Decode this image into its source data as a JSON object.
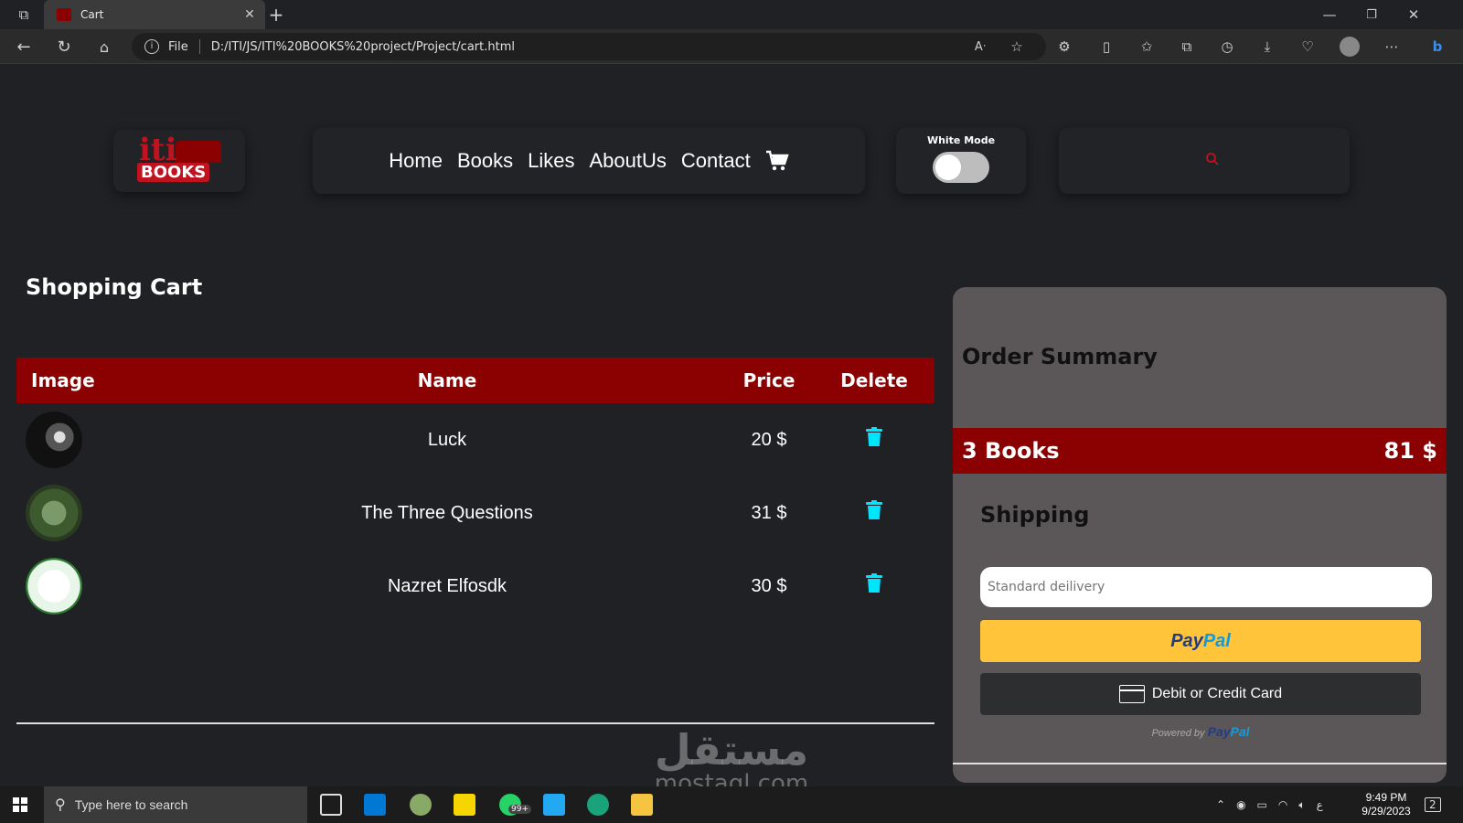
{
  "browser": {
    "tab_title": "Cart",
    "url_prefix": "File",
    "url": "D:/ITI/JS/ITI%20BOOKS%20project/Project/cart.html"
  },
  "header": {
    "logo_top": "iti",
    "logo_bottom": "BOOKS",
    "nav": [
      "Home",
      "Books",
      "Likes",
      "AboutUs",
      "Contact"
    ],
    "mode_label": "White Mode"
  },
  "cart": {
    "title": "Shopping Cart",
    "columns": [
      "Image",
      "Name",
      "Price",
      "Delete"
    ],
    "rows": [
      {
        "name": "Luck",
        "price": "20 $"
      },
      {
        "name": "The Three Questions",
        "price": "31 $"
      },
      {
        "name": "Nazret Elfosdk",
        "price": "30 $"
      }
    ]
  },
  "summary": {
    "title": "Order Summary",
    "count": "3 Books",
    "total": "81 $",
    "shipping_title": "Shipping",
    "shipping_placeholder": "Standard deilivery",
    "paypal_a": "Pay",
    "paypal_b": "Pal",
    "debit_label": "Debit or Credit Card",
    "powered_by": "Powered by",
    "powered_brand_a": "Pay",
    "powered_brand_b": "Pal"
  },
  "watermark": {
    "arabic": "مستقل",
    "latin": "mostaql.com"
  },
  "taskbar": {
    "search_placeholder": "Type here to search",
    "badge": "99+",
    "time": "9:49 PM",
    "date": "9/29/2023",
    "lang": "ع",
    "notifications": "2"
  },
  "colors": {
    "accent": "#8b0000",
    "trash": "#00e5ff",
    "panel": "#5b5758"
  }
}
